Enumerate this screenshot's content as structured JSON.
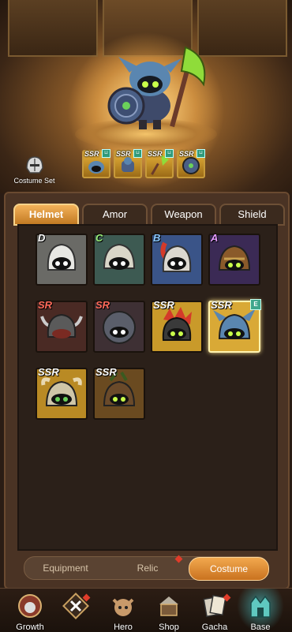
{
  "costume_set": {
    "label": "Costume Set"
  },
  "equipped_slots": [
    {
      "grade": "SSR",
      "color": "#e8b33a"
    },
    {
      "grade": "SSR",
      "color": "#e8b33a"
    },
    {
      "grade": "SSR",
      "color": "#e8b33a"
    },
    {
      "grade": "SSR",
      "color": "#e8b33a"
    }
  ],
  "tabs": [
    {
      "label": "Helmet",
      "active": true
    },
    {
      "label": "Amor",
      "active": false
    },
    {
      "label": "Weapon",
      "active": false
    },
    {
      "label": "Shield",
      "active": false
    }
  ],
  "items": [
    {
      "grade": "D",
      "grade_color": "#ffffff",
      "bg": "#6a6a66"
    },
    {
      "grade": "C",
      "grade_color": "#9bf07a",
      "bg": "#3d5a52"
    },
    {
      "grade": "B",
      "grade_color": "#8ac8ff",
      "bg": "#3a5488"
    },
    {
      "grade": "A",
      "grade_color": "#e59bff",
      "bg": "#3b2a55"
    },
    {
      "grade": "SR",
      "grade_color": "#ff6a5a",
      "bg": "#4a2a24"
    },
    {
      "grade": "SR",
      "grade_color": "#ff6a5a",
      "bg": "#3e3034"
    },
    {
      "grade": "SSR",
      "grade_color": "#ffffff",
      "bg": "#c99a2a"
    },
    {
      "grade": "SSR",
      "grade_color": "#ffffff",
      "bg": "#d9a936",
      "equipped": "E"
    },
    {
      "grade": "SSR",
      "grade_color": "#ffffff",
      "bg": "#b98a24"
    },
    {
      "grade": "SSR",
      "grade_color": "#ffffff",
      "bg": "#6a4a20"
    }
  ],
  "bottom_tabs": [
    {
      "label": "Equipment",
      "active": false
    },
    {
      "label": "Relic",
      "active": false
    },
    {
      "label": "Costume",
      "active": true
    }
  ],
  "nav": [
    {
      "label": "Growth",
      "icon": "growth-icon"
    },
    {
      "label": "",
      "icon": "battle-x-icon"
    },
    {
      "label": "Hero",
      "icon": "hero-icon"
    },
    {
      "label": "Shop",
      "icon": "shop-icon"
    },
    {
      "label": "Gacha",
      "icon": "gacha-icon"
    },
    {
      "label": "Base",
      "icon": "base-icon",
      "active": true
    }
  ]
}
